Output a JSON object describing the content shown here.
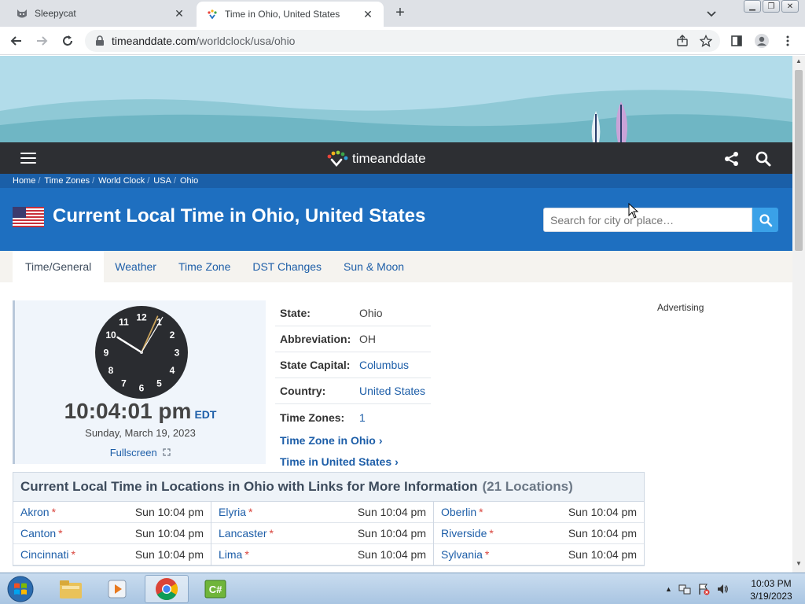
{
  "browser": {
    "tabs": [
      {
        "title": "Sleepycat",
        "active": false
      },
      {
        "title": "Time in Ohio, United States",
        "active": true
      }
    ],
    "url_host": "timeanddate.com",
    "url_path": "/worldclock/usa/ohio"
  },
  "site": {
    "logo_time": "time",
    "logo_anddate": "anddate",
    "breadcrumbs": [
      "Home",
      "Time Zones",
      "World Clock",
      "USA",
      "Ohio"
    ],
    "page_title": "Current Local Time in Ohio, United States",
    "search_placeholder": "Search for city or place…",
    "subnav": [
      "Time/General",
      "Weather",
      "Time Zone",
      "DST Changes",
      "Sun & Moon"
    ]
  },
  "clock": {
    "time": "10:04:01 pm",
    "tz": "EDT",
    "date": "Sunday, March 19, 2023",
    "fullscreen": "Fullscreen",
    "hour": 10,
    "minute": 4,
    "second": 1,
    "numbers": [
      "12",
      "1",
      "2",
      "3",
      "4",
      "5",
      "6",
      "7",
      "8",
      "9",
      "10",
      "11"
    ]
  },
  "info": [
    {
      "key": "State:",
      "value": "Ohio",
      "link": false
    },
    {
      "key": "Abbreviation:",
      "value": "OH",
      "link": false
    },
    {
      "key": "State Capital:",
      "value": "Columbus",
      "link": true
    },
    {
      "key": "Country:",
      "value": "United States",
      "link": true
    },
    {
      "key": "Time Zones:",
      "value": "1",
      "link": true
    }
  ],
  "info_links": [
    "Time Zone in Ohio",
    "Time in United States"
  ],
  "advertising": "Advertising",
  "locations": {
    "title": "Current Local Time in Locations in Ohio with Links for More Information",
    "count": "(21 Locations)",
    "columns": [
      [
        {
          "city": "Akron",
          "time": "Sun 10:04 pm"
        },
        {
          "city": "Canton",
          "time": "Sun 10:04 pm"
        },
        {
          "city": "Cincinnati",
          "time": "Sun 10:04 pm"
        }
      ],
      [
        {
          "city": "Elyria",
          "time": "Sun 10:04 pm"
        },
        {
          "city": "Lancaster",
          "time": "Sun 10:04 pm"
        },
        {
          "city": "Lima",
          "time": "Sun 10:04 pm"
        }
      ],
      [
        {
          "city": "Oberlin",
          "time": "Sun 10:04 pm"
        },
        {
          "city": "Riverside",
          "time": "Sun 10:04 pm"
        },
        {
          "city": "Sylvania",
          "time": "Sun 10:04 pm"
        }
      ]
    ]
  },
  "taskbar": {
    "time": "10:03 PM",
    "date": "3/19/2023",
    "apps": [
      "file-explorer",
      "media-player",
      "chrome",
      "csharp-editor"
    ]
  },
  "colors": {
    "site_blue": "#1e6fc0",
    "link_blue": "#1d5ea8",
    "dark_bar": "#2d2f33"
  }
}
